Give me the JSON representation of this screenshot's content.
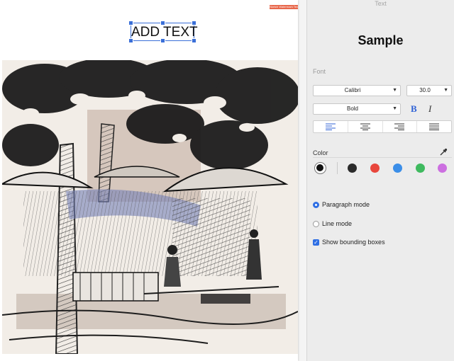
{
  "canvas": {
    "watermark_text": "Sketch Watermark Text",
    "textbox_text": "ADD TEXT"
  },
  "panel": {
    "title": "Text",
    "sample_text": "Sample",
    "font_label": "Font",
    "font_family": "Calibri",
    "font_size": "30.0",
    "font_weight": "Bold",
    "bold_label": "B",
    "italic_label": "I",
    "alignment_icons": [
      "align-left-icon",
      "align-center-icon",
      "align-right-icon",
      "align-justify-icon"
    ],
    "color_label": "Color",
    "colors": {
      "selected": "#111111",
      "swatches": [
        "#2b2b2b",
        "#e8463c",
        "#3b8ee8",
        "#3fba5f",
        "#cc6fe0"
      ]
    },
    "options": {
      "paragraph_mode": "Paragraph mode",
      "line_mode": "Line mode",
      "show_bounding_boxes": "Show bounding boxes"
    }
  }
}
